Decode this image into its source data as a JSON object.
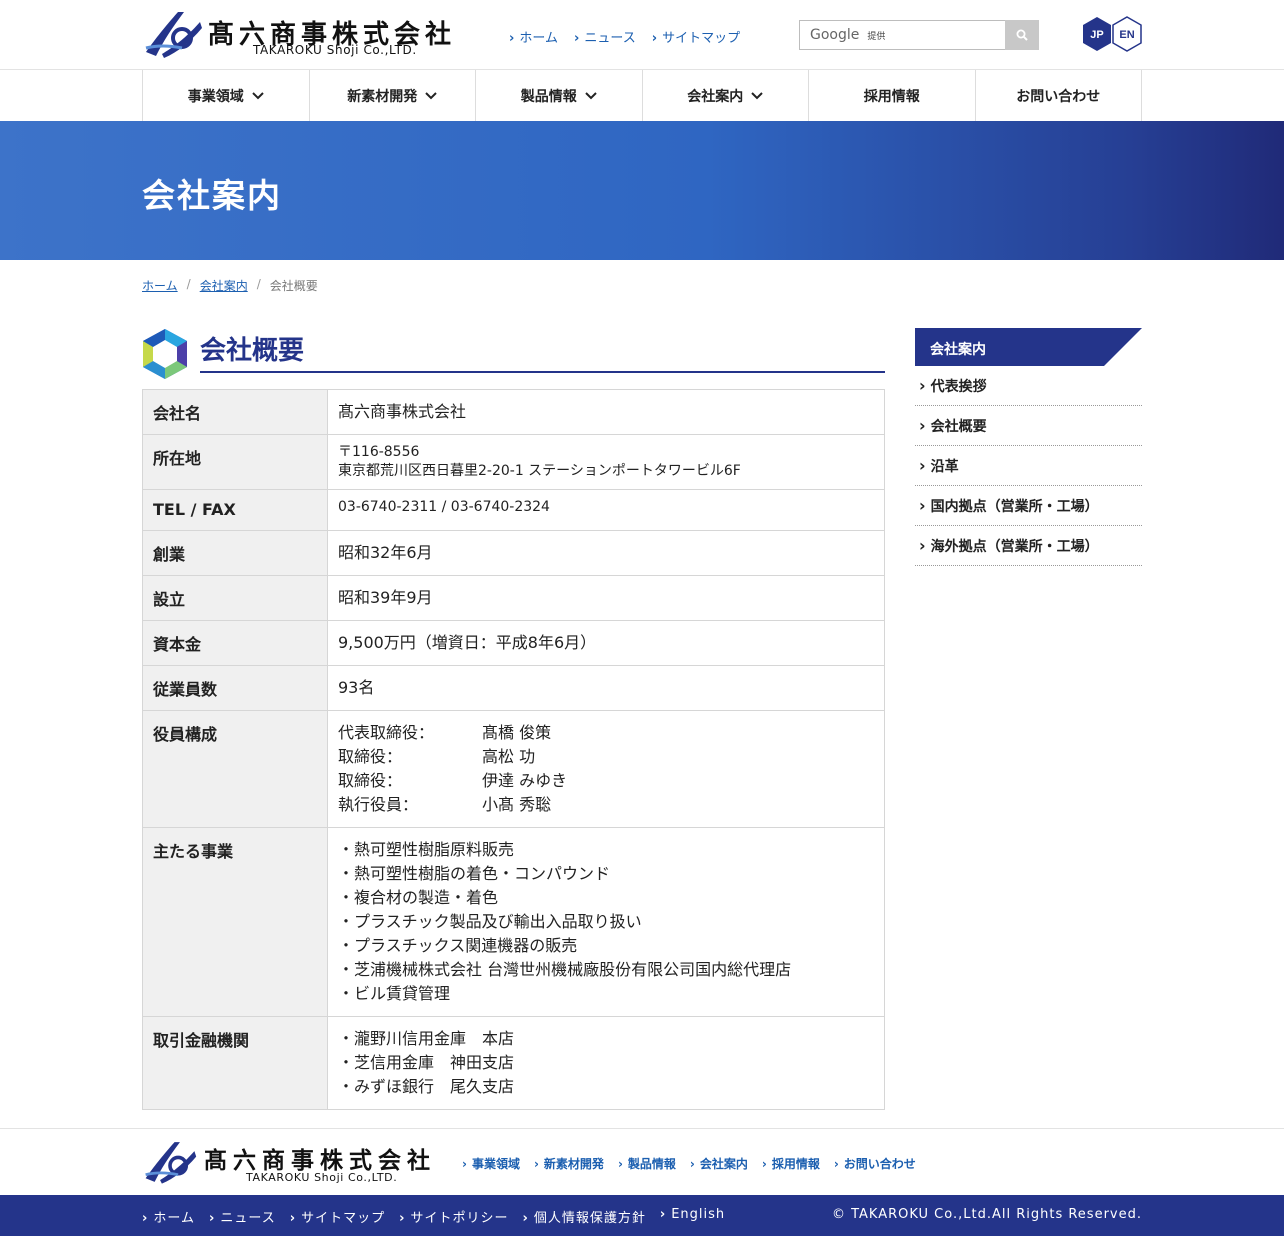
{
  "header": {
    "logo_jp": "髙六商事株式会社",
    "logo_en": "TAKAROKU Shoji Co.,LTD.",
    "top_links": [
      "ホーム",
      "ニュース",
      "サイトマップ"
    ],
    "search_brand": "Google",
    "search_provided": "提供",
    "lang_jp": "JP",
    "lang_en": "EN"
  },
  "nav": [
    {
      "label": "事業領域"
    },
    {
      "label": "新素材開発"
    },
    {
      "label": "製品情報"
    },
    {
      "label": "会社案内"
    },
    {
      "label": "採用情報"
    },
    {
      "label": "お問い合わせ"
    }
  ],
  "banner": {
    "title": "会社案内"
  },
  "breadcrumb": {
    "home": "ホーム",
    "parent": "会社案内",
    "current": "会社概要"
  },
  "section": {
    "title": "会社概要"
  },
  "table": {
    "company_label": "会社名",
    "company_value": "髙六商事株式会社",
    "address_label": "所在地",
    "address_zip": "〒116-8556",
    "address_line": "東京都荒川区西日暮里2-20-1 ステーションポートタワービル6F",
    "tel_label": "TEL / FAX",
    "tel_value": "03-6740-2311 / 03-6740-2324",
    "founded_label": "創業",
    "founded_value": "昭和32年6月",
    "established_label": "設立",
    "established_value": "昭和39年9月",
    "capital_label": "資本金",
    "capital_value": "9,500万円（増資日：平成8年6月）",
    "employees_label": "従業員数",
    "employees_value": "93名",
    "officers_label": "役員構成",
    "officers": [
      {
        "role": "代表取締役：",
        "name": "髙橋 俊策"
      },
      {
        "role": "取締役：",
        "name": "高松 功"
      },
      {
        "role": "取締役：",
        "name": "伊達 みゆき"
      },
      {
        "role": "執行役員：",
        "name": "小髙 秀聡"
      }
    ],
    "business_label": "主たる事業",
    "business": [
      "・熱可塑性樹脂原料販売",
      "・熱可塑性樹脂の着色・コンパウンド",
      "・複合材の製造・着色",
      "・プラスチック製品及び輸出入品取り扱い",
      "・プラスチックス関連機器の販売",
      "・芝浦機械株式会社 台灣世州機械廠股份有限公司国内総代理店",
      "・ビル賃貸管理"
    ],
    "banks_label": "取引金融機関",
    "banks": [
      "・瀧野川信用金庫　本店",
      "・芝信用金庫　神田支店",
      "・みずほ銀行　尾久支店"
    ]
  },
  "sidebar": {
    "heading": "会社案内",
    "items": [
      "代表挨拶",
      "会社概要",
      "沿革",
      "国内拠点（営業所・工場）",
      "海外拠点（営業所・工場）"
    ]
  },
  "footer": {
    "logo_jp": "髙六商事株式会社",
    "logo_en": "TAKAROKU Shoji Co.,LTD.",
    "links": [
      "事業領域",
      "新素材開発",
      "製品情報",
      "会社案内",
      "採用情報",
      "お問い合わせ"
    ],
    "bottom_links": [
      "ホーム",
      "ニュース",
      "サイトマップ",
      "サイトポリシー",
      "個人情報保護方針",
      "English"
    ],
    "copyright": "© TAKAROKU Co.,Ltd.All Rights Reserved."
  },
  "colors": {
    "brand": "#24348a",
    "link": "#1c5fb0",
    "banner_start": "#3d73c9",
    "banner_end": "#202a78"
  }
}
